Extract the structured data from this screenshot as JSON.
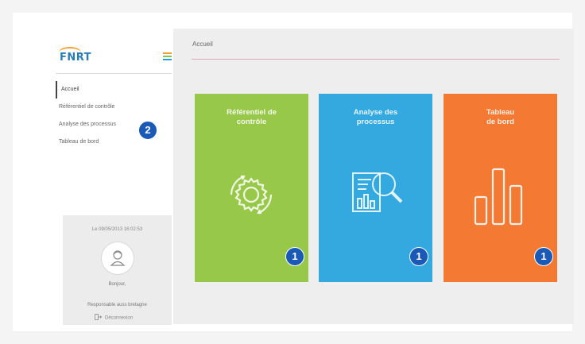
{
  "app": {
    "logo_text": "FNRT"
  },
  "sidebar": {
    "items": [
      {
        "label": "Accueil"
      },
      {
        "label": "Référentiel de contrôle"
      },
      {
        "label": "Analyse des processus"
      },
      {
        "label": "Tableau de bord"
      }
    ],
    "nav_badge": "2",
    "user_panel": {
      "datetime": "Le 09/05/2013 16:02:53",
      "greeting": "Bonjour,",
      "role": "Responsable auss bretagne",
      "logout_label": "Déconnexion"
    }
  },
  "main": {
    "title": "Accueil",
    "tiles": [
      {
        "title_line1": "Référentiel de",
        "title_line2": "contrôle",
        "badge": "1",
        "color": "#98c84a",
        "icon": "gear-icon"
      },
      {
        "title_line1": "Analyse des",
        "title_line2": "processus",
        "badge": "1",
        "color": "#33a9df",
        "icon": "document-magnifier-icon"
      },
      {
        "title_line1": "Tableau",
        "title_line2": "de bord",
        "badge": "1",
        "color": "#f47a34",
        "icon": "bar-chart-icon"
      }
    ]
  },
  "colors": {
    "badge": "#1a59b5",
    "accent_line": "#dba8b8"
  }
}
